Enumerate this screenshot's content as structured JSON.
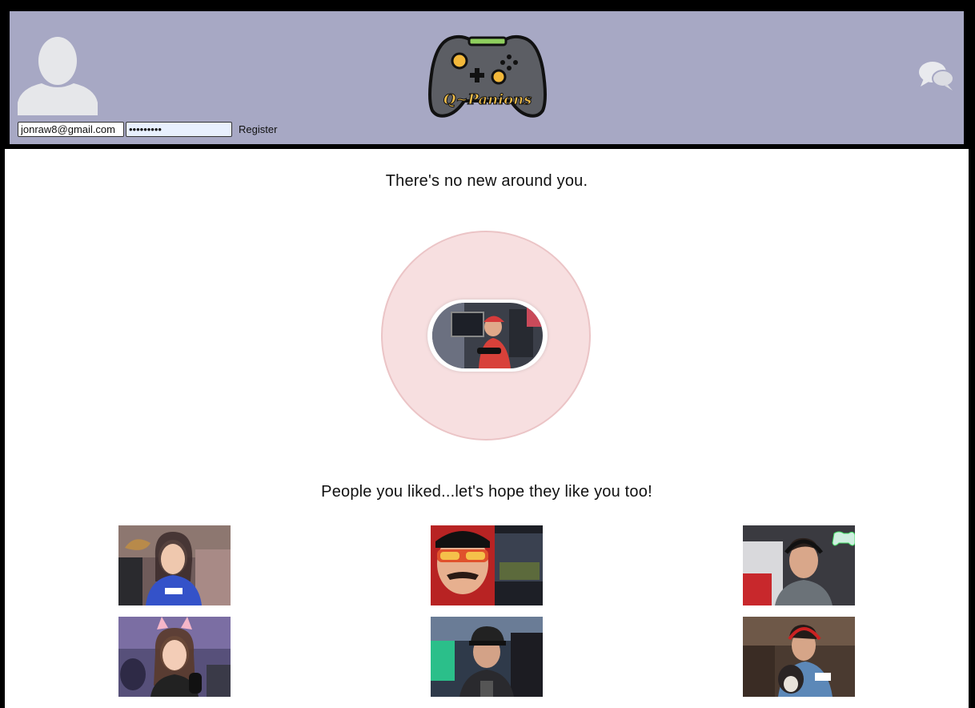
{
  "header": {
    "email_value": "jonraw8@gmail.com",
    "password_value": "•••••••••",
    "register_label": "Register",
    "logo_text": "Q~Panions"
  },
  "main": {
    "no_new_text": "There's no new around you.",
    "liked_heading": "People you liked...let's hope they like you too!"
  },
  "icons": {
    "avatar": "default-user-avatar",
    "chat": "chat-bubbles-icon",
    "logo": "game-controller-logo"
  },
  "colors": {
    "header_bg": "#a7a8c4",
    "radar_fill": "#f7dfe0",
    "radar_border": "#ebc4c6"
  },
  "liked_people": [
    {
      "photo": "streamer-woman-blue-shirt"
    },
    {
      "photo": "streamer-man-red-sunglasses"
    },
    {
      "photo": "streamer-man-headset-gamepad"
    },
    {
      "photo": "streamer-woman-cat-headphones"
    },
    {
      "photo": "streamer-man-black-cap"
    },
    {
      "photo": "streamer-man-laughing-with-dog"
    }
  ]
}
